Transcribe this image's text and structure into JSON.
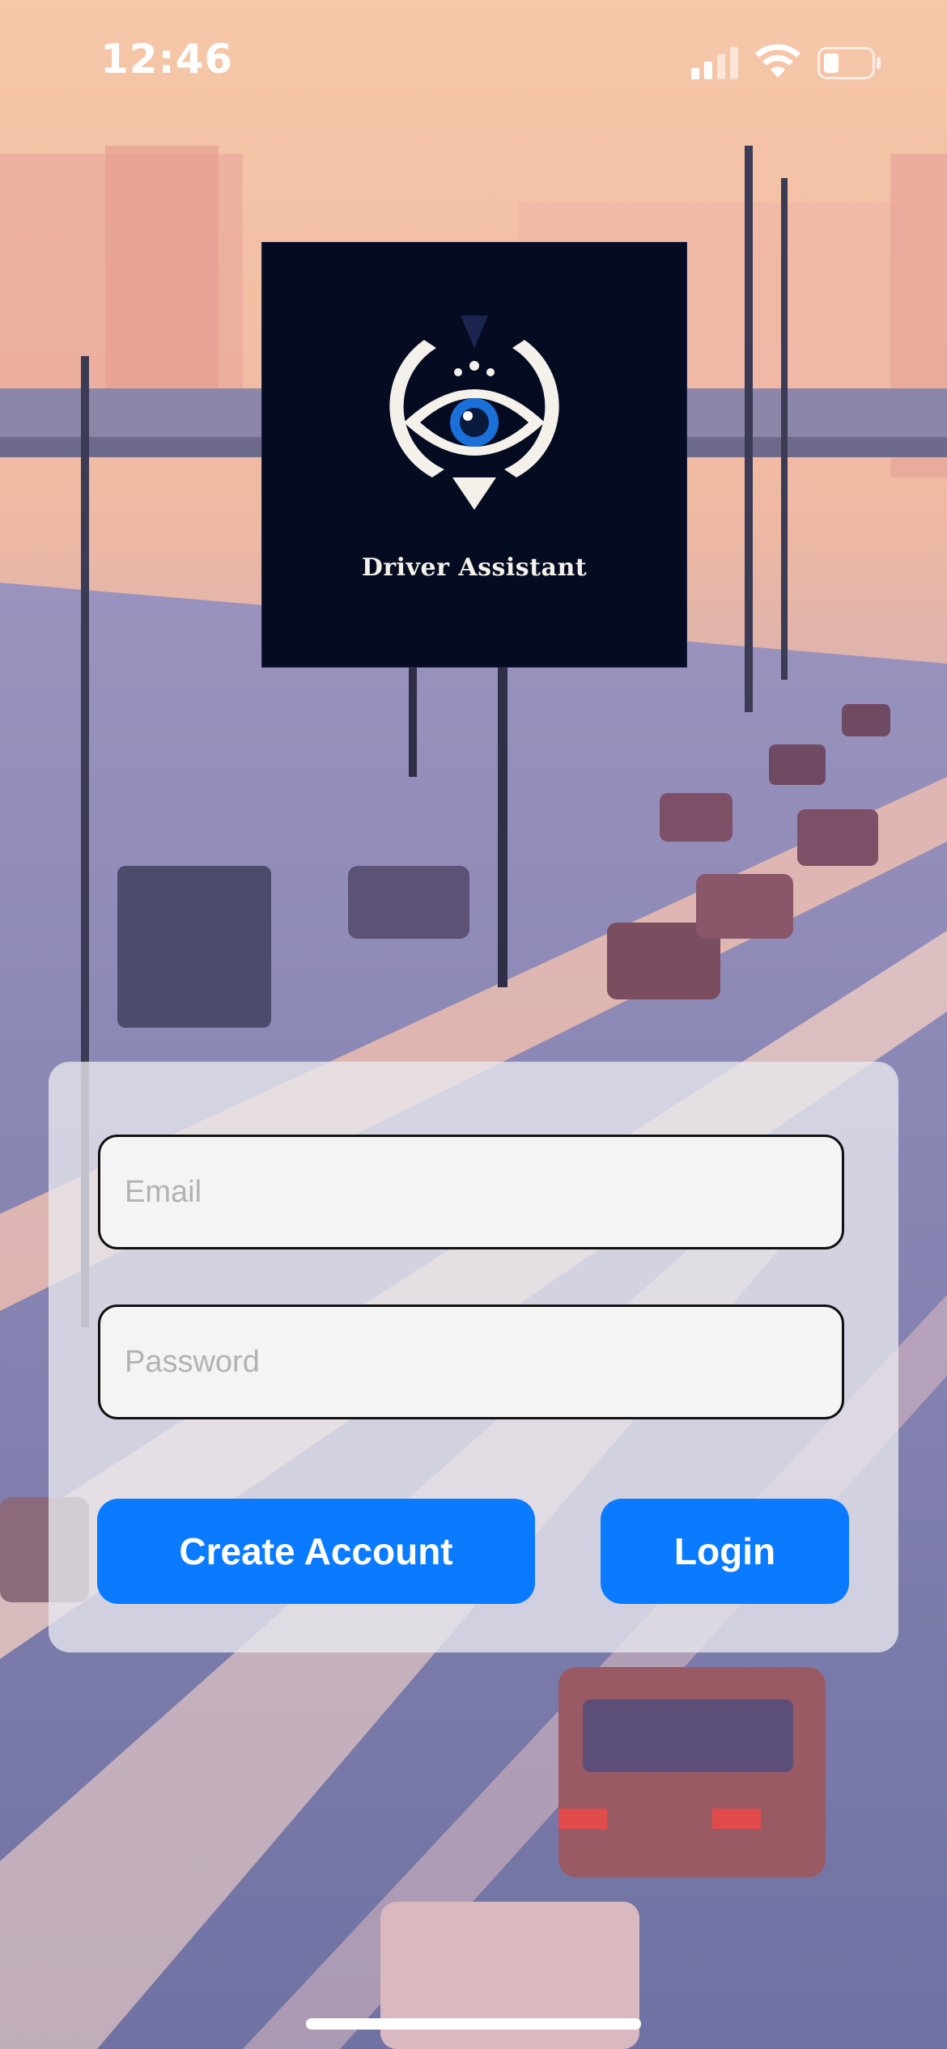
{
  "status_bar": {
    "time": "12:46",
    "icons": [
      "signal-icon",
      "wifi-icon",
      "battery-icon"
    ]
  },
  "logo": {
    "title": "Driver Assistant",
    "icon": "eye-icon",
    "background_color": "#050b20",
    "accent_color": "#1a6fd8"
  },
  "login_form": {
    "email": {
      "placeholder": "Email",
      "value": ""
    },
    "password": {
      "placeholder": "Password",
      "value": ""
    },
    "create_account_label": "Create Account",
    "login_label": "Login",
    "button_color": "#0a7aff"
  },
  "background": {
    "description_icon": "highway-traffic-illustration"
  }
}
